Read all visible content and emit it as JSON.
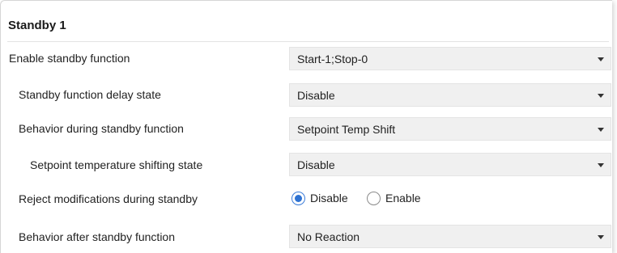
{
  "section": {
    "title": "Standby 1"
  },
  "rows": [
    {
      "label": "Enable standby function",
      "value": "Start-1;Stop-0"
    },
    {
      "label": "Standby function delay state",
      "value": "Disable"
    },
    {
      "label": "Behavior during standby function",
      "value": "Setpoint Temp Shift"
    },
    {
      "label": "Setpoint temperature shifting state",
      "value": "Disable"
    },
    {
      "label": "Reject modifications during standby",
      "options": [
        "Disable",
        "Enable"
      ],
      "selected": "Disable"
    },
    {
      "label": "Behavior after standby function",
      "value": "No Reaction"
    }
  ],
  "colors": {
    "dropdown_bg": "#f0f0f0",
    "radio_selected": "#2e72d2"
  },
  "icons": {
    "dropdown_arrow": "chevron-down-icon"
  }
}
